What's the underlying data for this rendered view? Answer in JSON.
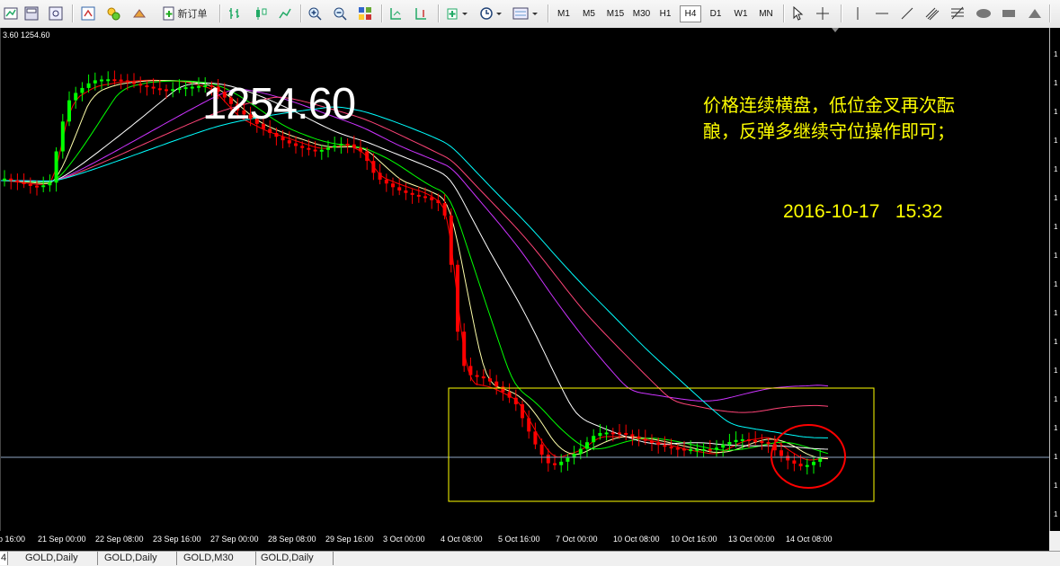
{
  "toolbar": {
    "new_order_label": "新订单",
    "timeframes": [
      "M1",
      "M5",
      "M15",
      "M30",
      "H1",
      "H4",
      "D1",
      "W1",
      "MN"
    ],
    "active_timeframe": "H4"
  },
  "chart": {
    "ohlc_header": "3.60 1254.60",
    "big_price": "1254.60",
    "comment_text": "价格连续横盘，低位金叉再次酝酿，反弹多继续守位操作即可；",
    "timestamp": "2016-10-17   15:32",
    "colors": {
      "background": "#000000",
      "bull_candle": "#00ff00",
      "bear_candle": "#ff0000",
      "ma_fast": "#ff0000",
      "ma_2": "#ffffaa",
      "ma_3": "#00ff00",
      "ma_4": "#ffffff",
      "ma_5": "#cc33ff",
      "ma_6": "#ff4477",
      "ma_7": "#00ffff",
      "annotation": "#ffff00",
      "circle": "#ff0000"
    }
  },
  "xaxis": {
    "labels": [
      "p 16:00",
      "21 Sep 00:00",
      "22 Sep 08:00",
      "23 Sep 16:00",
      "27 Sep 00:00",
      "28 Sep 08:00",
      "29 Sep 16:00",
      "3 Oct 00:00",
      "4 Oct 08:00",
      "5 Oct 16:00",
      "7 Oct 00:00",
      "10 Oct 08:00",
      "10 Oct 16:00",
      "13 Oct 00:00",
      "14 Oct 08:00"
    ]
  },
  "tabs": [
    "4",
    "GOLD,Daily",
    "GOLD,Daily",
    "GOLD,M30",
    "GOLD,Daily"
  ]
}
